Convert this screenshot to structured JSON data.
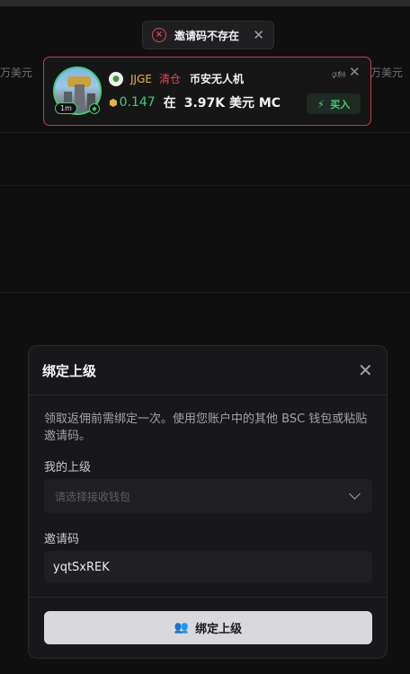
{
  "background": {
    "left_partial_text": "万美元",
    "right_partial_text": "万美元"
  },
  "toast": {
    "message": "邀请码不存在",
    "icon": "error-circle-icon",
    "close_icon": "close-icon"
  },
  "notification": {
    "avatar_age": "1m",
    "token_ticker": "JJGE",
    "action": "清仓",
    "token_name": "币安无人机",
    "amount": "0.147",
    "at_label": "在",
    "market_cap": "3.97K 美元 MC",
    "buy_label": "买入",
    "colors": {
      "border": "#c0424a",
      "amount": "#3fcf79",
      "ticker": "#e6b43c",
      "action": "#e0474f"
    }
  },
  "dialog": {
    "title": "绑定上级",
    "description": "领取返佣前需绑定一次。使用您账户中的其他 BSC 钱包或粘贴邀请码。",
    "superior_label": "我的上级",
    "superior_placeholder": "请选择接收钱包",
    "invite_label": "邀请码",
    "invite_value": "yqtSxREK",
    "submit_label": "绑定上级"
  }
}
